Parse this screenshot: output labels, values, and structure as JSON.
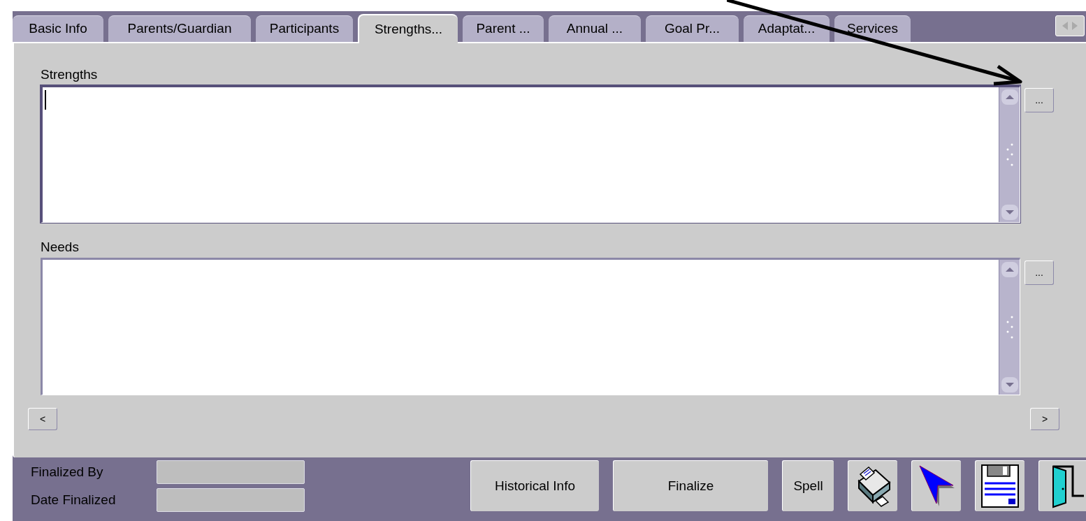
{
  "tabs": [
    {
      "label": "Basic Info",
      "selected": false
    },
    {
      "label": "Parents/Guardian",
      "selected": false
    },
    {
      "label": "Participants",
      "selected": false
    },
    {
      "label": "Strengths...",
      "selected": true
    },
    {
      "label": "Parent ...",
      "selected": false
    },
    {
      "label": "Annual ...",
      "selected": false
    },
    {
      "label": "Goal Pr...",
      "selected": false
    },
    {
      "label": "Adaptat...",
      "selected": false
    },
    {
      "label": "Services",
      "selected": false
    }
  ],
  "text_areas": [
    {
      "label": "Strengths",
      "focused": true,
      "button": "..."
    },
    {
      "label": "Needs",
      "focused": false,
      "button": "..."
    }
  ],
  "nav_buttons": [
    "<",
    ">"
  ],
  "footer_fields": [
    {
      "label": "Finalized By"
    },
    {
      "label": "Date Finalized"
    }
  ],
  "footer_buttons": [
    {
      "kind": "text",
      "label": "Historical Info"
    },
    {
      "kind": "text",
      "label": "Finalize"
    },
    {
      "kind": "text",
      "label": "Spell"
    },
    {
      "kind": "printer"
    },
    {
      "kind": "pointer"
    },
    {
      "kind": "save"
    },
    {
      "kind": "exit"
    }
  ]
}
